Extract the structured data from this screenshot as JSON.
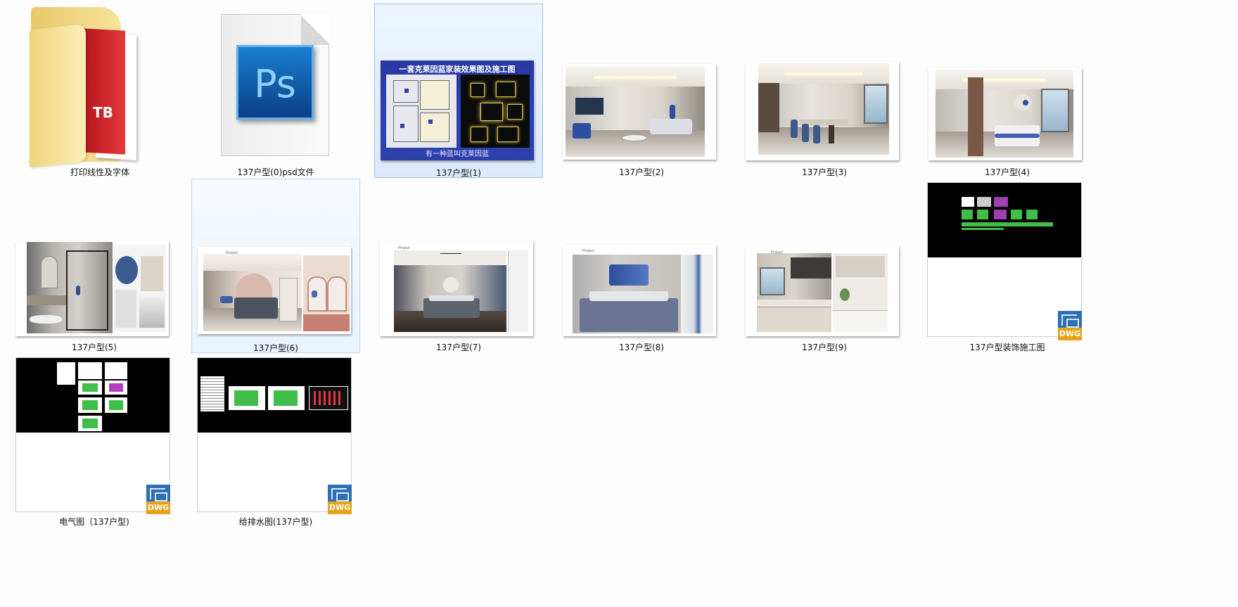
{
  "files": [
    {
      "id": "folder",
      "label": "打印线性及字体",
      "icon": "folder-with-pdf-icon"
    },
    {
      "id": "psd",
      "label": "137户型(0)psd文件",
      "icon": "photoshop-file-icon",
      "glyph": "Ps"
    },
    {
      "id": "img1",
      "label": "137户型(1)",
      "state": "selected",
      "title": "一套克莱因蓝家装效果图及施工图",
      "caption": "有一种蓝叫克莱因蓝"
    },
    {
      "id": "img2",
      "label": "137户型(2)"
    },
    {
      "id": "img3",
      "label": "137户型(3)"
    },
    {
      "id": "img4",
      "label": "137户型(4)"
    },
    {
      "id": "img5",
      "label": "137户型(5)"
    },
    {
      "id": "img6",
      "label": "137户型(6)",
      "state": "hover"
    },
    {
      "id": "img7",
      "label": "137户型(7)"
    },
    {
      "id": "img8",
      "label": "137户型(8)"
    },
    {
      "id": "img9",
      "label": "137户型(9)"
    },
    {
      "id": "dwg1",
      "label": "137户型装饰施工图",
      "badge": "DWG"
    },
    {
      "id": "dwg2",
      "label": "电气图（137户型)",
      "badge": "DWG"
    },
    {
      "id": "dwg3",
      "label": "给排水图(137户型)",
      "badge": "DWG"
    }
  ],
  "colors": {
    "selection": "#99c4ee",
    "klein_blue": "#2e3fa8",
    "ps_blue": "#0d5fb3",
    "dwg_blue": "#2f6fb5",
    "dwg_orange": "#e8a31a"
  }
}
